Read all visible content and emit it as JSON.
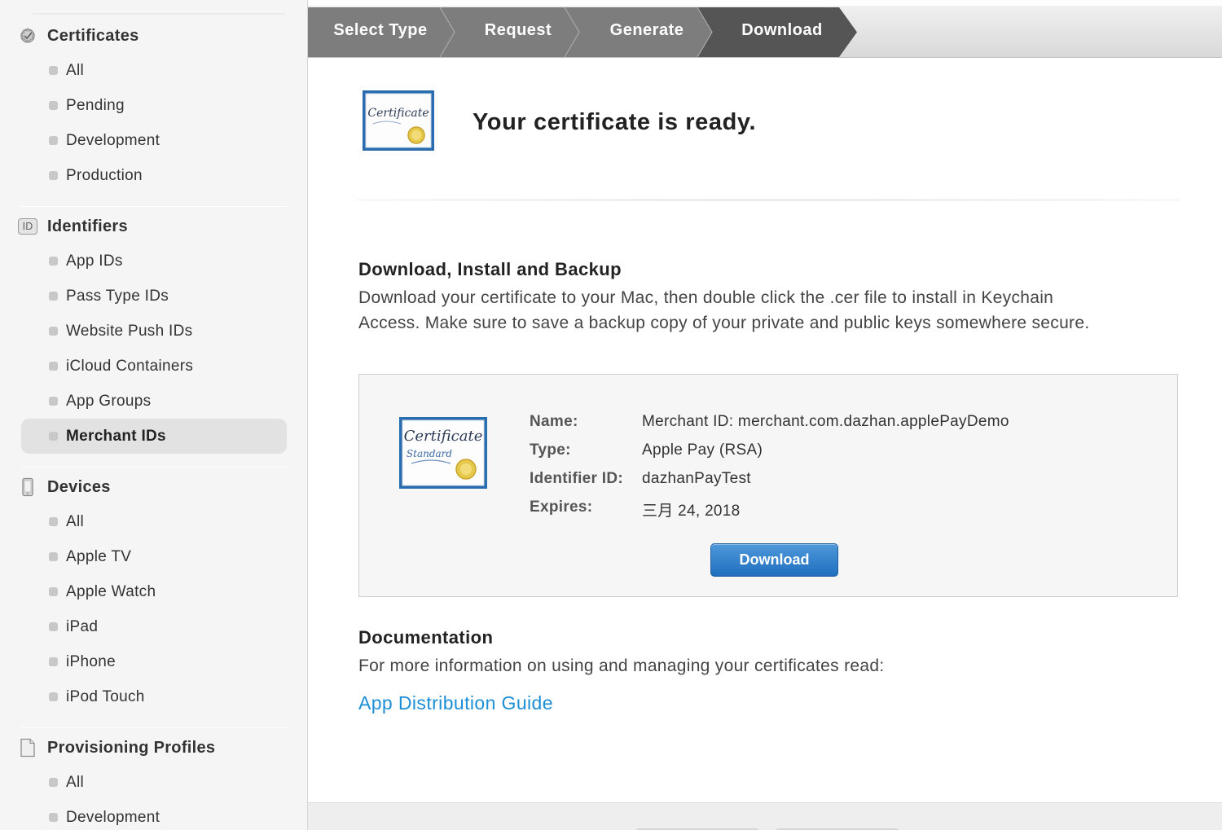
{
  "sidebar": {
    "sections": [
      {
        "title": "Certificates",
        "icon": "certificate-gear-icon",
        "items": [
          {
            "label": "All"
          },
          {
            "label": "Pending"
          },
          {
            "label": "Development"
          },
          {
            "label": "Production"
          }
        ]
      },
      {
        "title": "Identifiers",
        "icon": "id-badge-icon",
        "icon_text": "ID",
        "items": [
          {
            "label": "App IDs"
          },
          {
            "label": "Pass Type IDs"
          },
          {
            "label": "Website Push IDs"
          },
          {
            "label": "iCloud Containers"
          },
          {
            "label": "App Groups"
          },
          {
            "label": "Merchant IDs",
            "active": true
          }
        ]
      },
      {
        "title": "Devices",
        "icon": "device-phone-icon",
        "items": [
          {
            "label": "All"
          },
          {
            "label": "Apple TV"
          },
          {
            "label": "Apple Watch"
          },
          {
            "label": "iPad"
          },
          {
            "label": "iPhone"
          },
          {
            "label": "iPod Touch"
          }
        ]
      },
      {
        "title": "Provisioning Profiles",
        "icon": "document-icon",
        "items": [
          {
            "label": "All"
          },
          {
            "label": "Development"
          }
        ]
      }
    ]
  },
  "wizard": {
    "steps": [
      "Select Type",
      "Request",
      "Generate",
      "Download"
    ],
    "active_step": "Download"
  },
  "main": {
    "cert_icon_text": "Certificate",
    "ready_title": "Your certificate is ready.",
    "install_heading": "Download, Install and Backup",
    "install_text_line1": "Download your certificate to your Mac, then double click the .cer file to install in Keychain",
    "install_text_line2": "Access. Make sure to save a backup copy of your private and public keys somewhere secure.",
    "details": {
      "cert_icon_text": "Certificate",
      "cert_icon_subtext": "Standard",
      "name_label": "Name:",
      "name_value": "Merchant ID: merchant.com.dazhan.applePayDemo",
      "type_label": "Type:",
      "type_value": "Apple Pay (RSA)",
      "identifier_label": "Identifier ID:",
      "identifier_value": "dazhanPayTest",
      "expires_label": "Expires:",
      "expires_value": "三月 24, 2018",
      "download_label": "Download"
    },
    "doc_heading": "Documentation",
    "doc_text": "For more information on using and managing your certificates read:",
    "doc_link": "App Distribution Guide"
  },
  "colors": {
    "wizard_step": "#7d7d7d",
    "wizard_active": "#555555",
    "accent_button": "#2b7dcc",
    "link": "#1d8fd6",
    "cert_frame": "#2a6cb0",
    "seal": "#e6c84a"
  }
}
